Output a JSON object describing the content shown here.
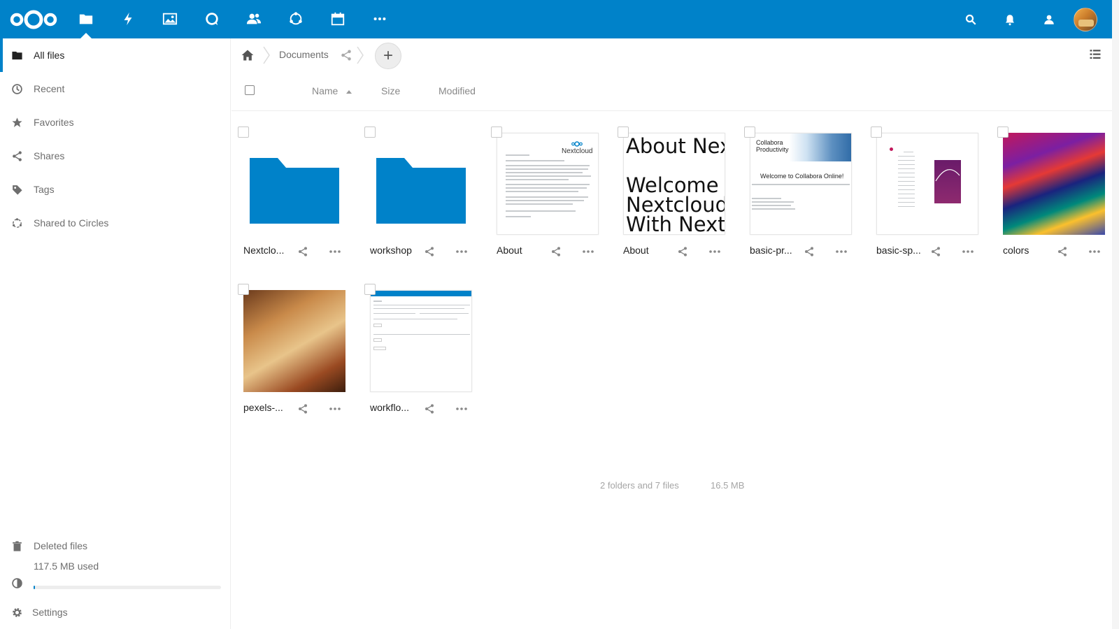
{
  "colors": {
    "primary": "#0082c9",
    "header_icon": "#ffffff",
    "muted_text": "#6e6e6e",
    "folder": "#0082c9"
  },
  "header": {
    "logo": "nextcloud-logo",
    "apps": [
      {
        "name": "files-icon",
        "active": true
      },
      {
        "name": "activity-icon"
      },
      {
        "name": "gallery-icon"
      },
      {
        "name": "talk-icon"
      },
      {
        "name": "contacts-icon"
      },
      {
        "name": "circles-icon"
      },
      {
        "name": "calendar-icon"
      },
      {
        "name": "more-apps-icon"
      }
    ],
    "right_icons": [
      "search-icon",
      "notifications-icon",
      "contacts-menu-icon",
      "user-avatar"
    ]
  },
  "sidebar": {
    "items": [
      {
        "label": "All files",
        "icon": "folder-icon",
        "active": true
      },
      {
        "label": "Recent",
        "icon": "clock-icon"
      },
      {
        "label": "Favorites",
        "icon": "star-icon"
      },
      {
        "label": "Shares",
        "icon": "share-icon"
      },
      {
        "label": "Tags",
        "icon": "tag-icon"
      },
      {
        "label": "Shared to Circles",
        "icon": "circles-icon"
      }
    ],
    "deleted": {
      "label": "Deleted files",
      "icon": "trash-icon"
    },
    "quota": {
      "label": "117.5 MB used",
      "icon": "pie-chart-icon",
      "fraction": 0.005
    },
    "settings": {
      "label": "Settings",
      "icon": "gear-icon"
    }
  },
  "breadcrumb": {
    "home_icon": "home-icon",
    "current": "Documents",
    "share_icon": "share-icon",
    "add_button": "+"
  },
  "columns": {
    "name": "Name",
    "size": "Size",
    "modified": "Modified"
  },
  "files": [
    {
      "name": "Nextclo...",
      "type": "folder"
    },
    {
      "name": "workshop",
      "type": "folder"
    },
    {
      "name": "About",
      "type": "document"
    },
    {
      "name": "About",
      "type": "text"
    },
    {
      "name": "basic-pr...",
      "type": "presentation"
    },
    {
      "name": "basic-sp...",
      "type": "spreadsheet"
    },
    {
      "name": "colors",
      "type": "image"
    },
    {
      "name": "pexels-...",
      "type": "image"
    },
    {
      "name": "workflo...",
      "type": "screenshot"
    }
  ],
  "thumb_text": {
    "nextcloud_logo_text": "Nextcloud",
    "about_text_lines": [
      "About Nex",
      "Welcome t",
      "Nextcloud",
      "With Nextc"
    ],
    "collabora_title": "Collabora Productivity",
    "collabora_welcome": "Welcome to Collabora Online!"
  },
  "summary": {
    "counts": "2 folders and 7 files",
    "size": "16.5 MB"
  }
}
